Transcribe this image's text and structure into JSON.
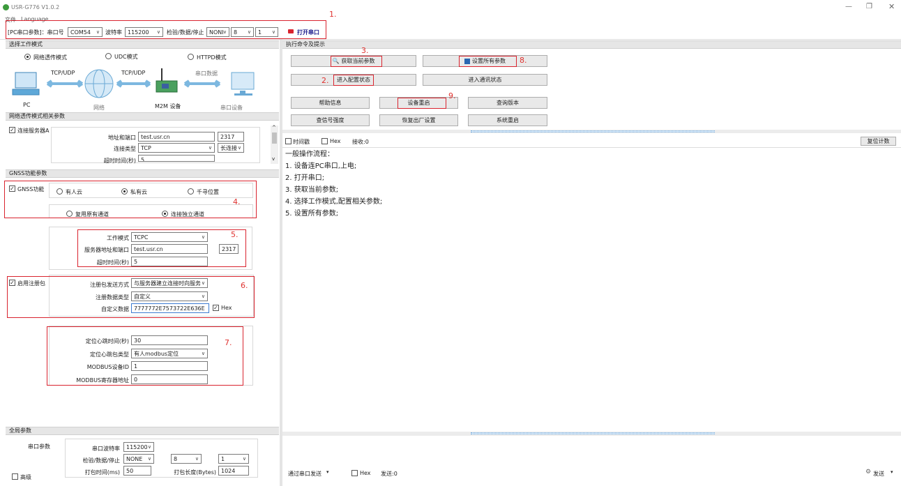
{
  "window": {
    "title": "USR-G776 V1.0.2",
    "menu": [
      "文件",
      "Language"
    ]
  },
  "top_bar": {
    "pc_params": "[PC串口参数]：串口号",
    "port": "COM54",
    "baud_label": "波特率",
    "baud": "115200",
    "check_label": "检验/数据/停止",
    "parity": "NONI",
    "databits": "8",
    "stopbits": "1",
    "open_port": "打开串口"
  },
  "annotations": [
    "1.",
    "2.",
    "3.",
    "4.",
    "5.",
    "6.",
    "7.",
    "8.",
    "9."
  ],
  "work_mode": {
    "header": "选择工作模式",
    "modes": [
      "网络透传模式",
      "UDC模式",
      "HTTPD模式"
    ],
    "diagram": {
      "pc": "PC",
      "net": "网络",
      "m2m": "M2M 设备",
      "serial": "串口设备",
      "link1": "TCP/UDP",
      "link2": "TCP/UDP",
      "link3": "串口数据"
    }
  },
  "net_params": {
    "header": "网络透传模式相关参数",
    "server_a": "连接服务器A",
    "addr_label": "地址和端口",
    "addr": "test.usr.cn",
    "port": "2317",
    "conn_type_label": "连接类型",
    "conn_type": "TCP",
    "long_conn": "长连接",
    "timeout_label": "超时时间(秒)",
    "timeout": "5"
  },
  "gnss": {
    "header": "GNSS功能参数",
    "enable": "GNSS功能",
    "cloud_options": [
      "有人云",
      "私有云",
      "千寻位置"
    ],
    "channel_options": [
      "复用原有通道",
      "连接独立通道"
    ],
    "work_mode_label": "工作模式",
    "work_mode": "TCPC",
    "server_label": "服务器地址和端口",
    "server": "test.usr.cn",
    "server_port": "2317",
    "timeout_label": "超时时间(秒)",
    "timeout": "5"
  },
  "register": {
    "enable": "启用注册包",
    "send_mode_label": "注册包发送方式",
    "send_mode": "与服务器建立连接时向服务",
    "data_type_label": "注册数据类型",
    "data_type": "自定义",
    "custom_label": "自定义数据",
    "custom": "7777772E7573722E636E",
    "hex": "Hex"
  },
  "heartbeat": {
    "interval_label": "定位心跳时间(秒)",
    "interval": "30",
    "type_label": "定位心跳包类型",
    "type": "有人modbus定位",
    "modbus_id_label": "MODBUS设备ID",
    "modbus_id": "1",
    "modbus_addr_label": "MODBUS寄存器地址",
    "modbus_addr": "0"
  },
  "global": {
    "header": "全局参数",
    "serial_params": "串口参数",
    "baud_label": "串口波特率",
    "baud": "115200",
    "check_label": "检验/数据/停止",
    "parity": "NONE",
    "databits": "8",
    "stopbits": "1",
    "pack_time_label": "打包时间(ms)",
    "pack_time": "50",
    "pack_len_label": "打包长度(Bytes)",
    "pack_len": "1024",
    "advanced": "高级"
  },
  "commands": {
    "header": "执行命令及提示",
    "get_params": "获取当前参数",
    "set_all": "设置所有参数",
    "enter_config": "进入配置状态",
    "enter_comm": "进入通讯状态",
    "help": "帮助信息",
    "restart": "设备重启",
    "query_version": "查询版本",
    "query_signal": "查信号强度",
    "factory_reset": "恢复出厂设置",
    "system_restart": "系统重启"
  },
  "log": {
    "timestamp": "时间戳",
    "hex": "Hex",
    "recv": "接收:0",
    "reset_count": "复位计数",
    "lines": [
      "一般操作流程：",
      "1. 设备连PC串口,上电;",
      "2. 打开串口;",
      "3. 获取当前参数;",
      "4. 选择工作模式,配置相关参数;",
      "5. 设置所有参数;"
    ]
  },
  "send": {
    "via_serial": "通过串口发送",
    "hex": "Hex",
    "sent": "发送:0",
    "send_btn": "发送"
  }
}
